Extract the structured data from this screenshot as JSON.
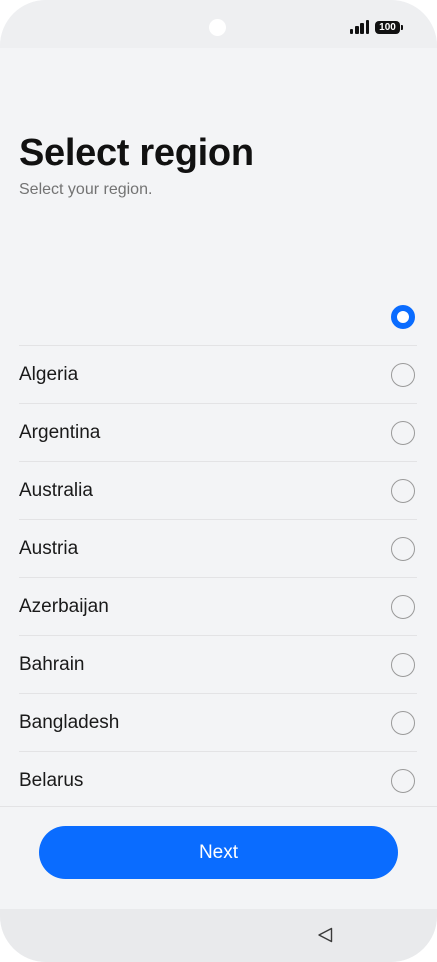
{
  "status_bar": {
    "battery_level": "100",
    "icons": [
      "camera-icon",
      "signal-icon",
      "battery-icon"
    ]
  },
  "header": {
    "title": "Select region",
    "subtitle": "Select your region."
  },
  "regions": [
    {
      "label": "",
      "selected": true
    },
    {
      "label": "Algeria",
      "selected": false
    },
    {
      "label": "Argentina",
      "selected": false
    },
    {
      "label": "Australia",
      "selected": false
    },
    {
      "label": "Austria",
      "selected": false
    },
    {
      "label": "Azerbaijan",
      "selected": false
    },
    {
      "label": "Bahrain",
      "selected": false
    },
    {
      "label": "Bangladesh",
      "selected": false
    },
    {
      "label": "Belarus",
      "selected": false
    }
  ],
  "footer": {
    "next_label": "Next"
  },
  "nav_bar": {
    "icons": [
      "back-triangle-icon"
    ]
  },
  "colors": {
    "accent": "#0a6cff",
    "background": "#f3f4f6",
    "title_text": "#111111",
    "subtitle_text": "#737373"
  }
}
